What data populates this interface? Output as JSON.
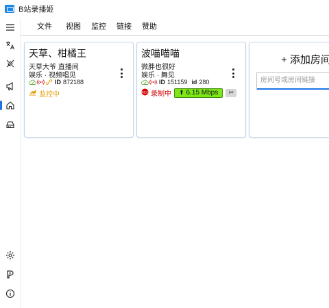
{
  "app": {
    "title": "B站录播姬"
  },
  "sidebar": {
    "items": [
      {
        "icon": "menu-icon"
      },
      {
        "icon": "translate-icon"
      },
      {
        "icon": "disconnect-icon"
      },
      {
        "icon": "announce-icon"
      },
      {
        "icon": "home-icon",
        "active": true
      },
      {
        "icon": "drive-icon"
      },
      {
        "icon": "gear-icon"
      },
      {
        "icon": "toolbox-icon"
      },
      {
        "icon": "info-icon"
      }
    ]
  },
  "menu": {
    "file": "文件",
    "view": "视图",
    "monitor": "监控",
    "link": "链接",
    "sponsor": "赞助"
  },
  "rooms": [
    {
      "name": "天草、柑橘王",
      "title": "天草大爷 直播间",
      "area": "娱乐 · 视频唱见",
      "id_label": "ID",
      "room_id": "872188",
      "short_id": "",
      "status": "监控中",
      "status_color": "#e39b00"
    },
    {
      "name": "波喵喵喵",
      "title": "微胖也很好",
      "area": "娱乐 · 舞见",
      "id_label": "ID",
      "room_id": "151159",
      "short_id_label": "id",
      "short_id": "280",
      "status": "录制中",
      "status_color": "#d40000",
      "speed": "6.15 Mbps",
      "cut_label": "✂"
    }
  ],
  "add_room": {
    "title": "+ 添加房间",
    "placeholder": "房间号或房间链接"
  },
  "colors": {
    "accent": "#1a73e8",
    "card_border": "#bcd4ec",
    "speed_badge": "#7ee817",
    "record": "#d40000",
    "monitor": "#e39b00"
  }
}
